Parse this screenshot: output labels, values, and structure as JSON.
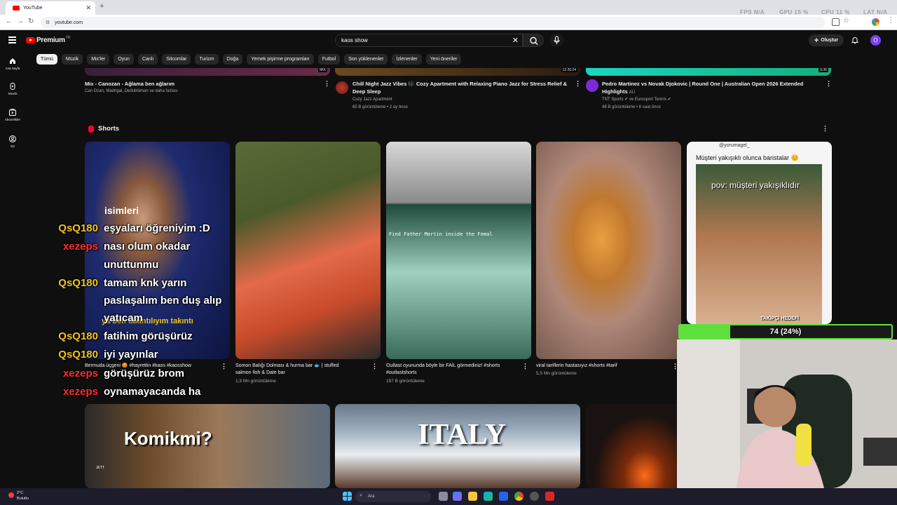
{
  "browser": {
    "tab_title": "YouTube",
    "new_tab": "+",
    "close": "✕",
    "url": "youtube.com",
    "hud": {
      "fps": "FPS N/A",
      "gpu": "GPU 15 %",
      "cpu": "CPU 11 %",
      "lat": "LAT N/A"
    }
  },
  "header": {
    "logo": "Premium",
    "logo_region": "TR",
    "search_value": "kaos show",
    "create_label": "Oluştur",
    "avatar_letter": "O"
  },
  "sidebar": {
    "items": [
      {
        "label": "Ana Sayfa",
        "icon": "home-icon"
      },
      {
        "label": "Shorts",
        "icon": "shorts-icon"
      },
      {
        "label": "Abonelikler",
        "icon": "subscriptions-icon"
      },
      {
        "label": "Siz",
        "icon": "user-icon"
      }
    ]
  },
  "chips": [
    "Tümü",
    "Müzik",
    "Mix'ler",
    "Oyun",
    "Canlı",
    "Sitcomlar",
    "Turizm",
    "Doğa",
    "Yemek pişirme programları",
    "Futbol",
    "Son yüklenenler",
    "İzlenenler",
    "Yeni öneriler"
  ],
  "top_videos": [
    {
      "title": "Mix - Canozan - Ağlama ben ağlarım",
      "meta1": "Can Ozan, Madrigal, Dedublüman ve daha fazlası",
      "meta2": "",
      "badge": "MIX"
    },
    {
      "title": "Chill Night Jazz Vibes 🎼 Cozy Apartment with Relaxing Piano Jazz for Stress Relief &",
      "title2": "Deep Sleep",
      "meta1": "Cozy Jazz Apartment",
      "meta2": "65 B görüntüleme • 2 ay önce",
      "badge": "12:26:24"
    },
    {
      "title": "Pedro Martinez vs Novak Djokovic | Round One | Australian Open 2026 Extended",
      "title2": "Highlights",
      "title2_suffix": "AU",
      "meta1": "TNT Sports ✔ ve Eurosport Tennis ✔",
      "meta2": "48 B görüntüleme • 6 saat önce",
      "badge": "9:36"
    }
  ],
  "shorts": {
    "heading": "Shorts",
    "items": [
      {
        "title": "Bermuda üçgeni 😡 #hayrettin #kaos #kaosshow",
        "title2": "",
        "views": ""
      },
      {
        "title": "Somon Balığı Dolması & hurma bar 🐟 | stuffed",
        "title2": "salmon fish & Date bar",
        "views": "1,9 Mn görüntüleme"
      },
      {
        "title": "Outlast oyununda böyle bir FAİL görmediniz! #shorts",
        "title2": "#outlastshorts",
        "views": "197 B görüntüleme"
      },
      {
        "title": "viral tariflerin hastasıyız #shorts #tarif",
        "title2": "",
        "views": "5,5 Mn görüntüleme"
      },
      {
        "title": "",
        "title2": "",
        "views": ""
      }
    ],
    "short_overlays": {
      "s1": "isimleri",
      "s1_sub": "ya ben takıntılıyım takıntı",
      "s3": "Find Father Martin inside the Femal",
      "s5_user": "@yorumagel_",
      "s5_caption": "Müşteri yakışıklı olunca baristalar 😊",
      "s5_pov": "pov: müşteri yakışıklıdır"
    }
  },
  "bottom_videos": [
    {
      "caption": "Komikmi?",
      "tag": "JETT"
    },
    {
      "caption": "ITALY"
    },
    {
      "caption": ""
    }
  ],
  "chat": [
    {
      "user": "QsQ180",
      "msg": "eşyaları öğreniyim :D",
      "color": "#f0c419"
    },
    {
      "user": "xezeps",
      "msg": "nası olum okadar",
      "color": "#ff2d2d"
    },
    {
      "user": "",
      "msg": "unuttunmu",
      "color": "#ffffff"
    },
    {
      "user": "QsQ180",
      "msg": "tamam knk yarın",
      "color": "#f0c419"
    },
    {
      "user": "",
      "msg": "paslaşalım ben duş alıp",
      "color": "#ffffff"
    },
    {
      "user": "",
      "msg": "yatıcam",
      "color": "#ffffff"
    },
    {
      "user": "QsQ180",
      "msg": "fatihim görüşürüz",
      "color": "#f0c419"
    },
    {
      "user": "QsQ180",
      "msg": "iyi yayınlar",
      "color": "#f0c419"
    },
    {
      "user": "xezeps",
      "msg": "görüşürüz brom",
      "color": "#ff2d2d"
    },
    {
      "user": "xezeps",
      "msg": "oynamayacanda ha",
      "color": "#ff2d2d"
    }
  ],
  "follower_goal": {
    "heading": "TAKİPÇİ HEDEFİ",
    "label": "74 (24%)",
    "fraction": 0.24
  },
  "taskbar": {
    "temp": "2°C",
    "weather": "Bulutlu",
    "search_placeholder": "Ara"
  },
  "colors": {
    "accent": "#ff0000",
    "goal": "#5de03b"
  }
}
